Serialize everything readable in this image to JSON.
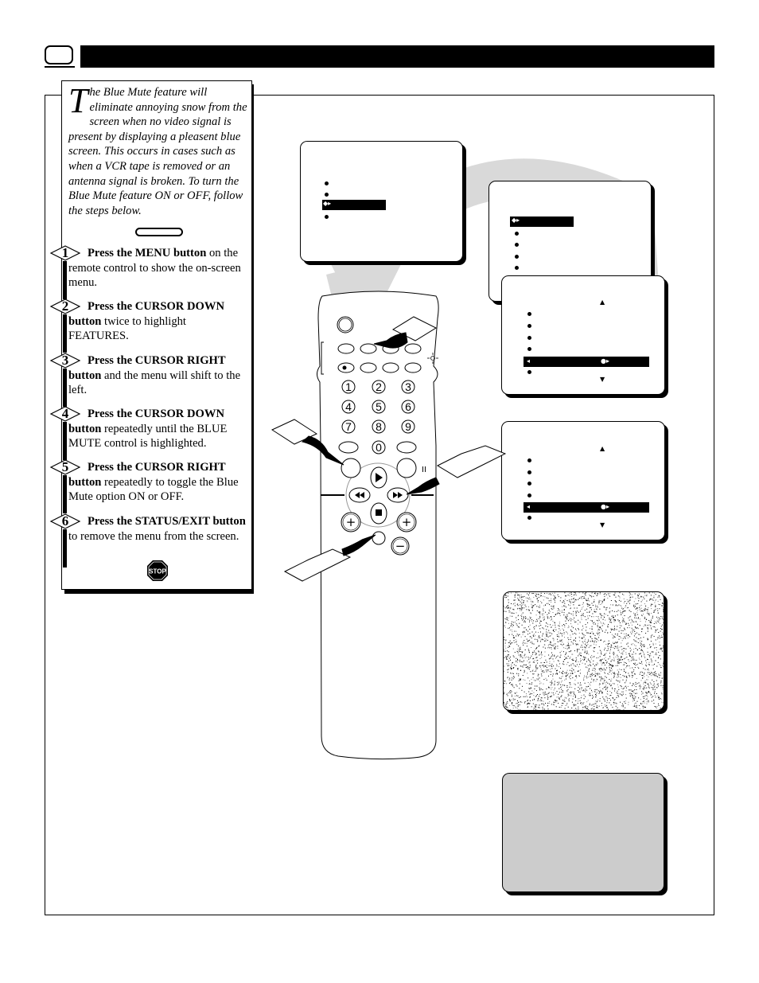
{
  "header": {
    "icon": "tv-icon",
    "title": ""
  },
  "intro": {
    "dropcap": "T",
    "text": "he Blue Mute feature will eliminate annoying snow from the screen when no video signal is present by displaying a pleasent blue screen. This occurs in cases such as when a VCR tape is removed or an antenna signal is broken. To turn the Blue Mute feature ON or OFF, follow the steps below."
  },
  "steps": [
    {
      "number": "1",
      "bold": "Press the MENU button",
      "rest": " on the remote control to show the on-screen menu."
    },
    {
      "number": "2",
      "bold": "Press the CURSOR DOWN button",
      "rest": " twice to highlight FEATURES."
    },
    {
      "number": "3",
      "bold": "Press the CURSOR RIGHT button",
      "rest": " and the menu will shift to the left."
    },
    {
      "number": "4",
      "bold": "Press the CURSOR DOWN button",
      "rest": " repeatedly until the BLUE MUTE control is highlighted."
    },
    {
      "number": "5",
      "bold": "Press the CURSOR RIGHT button",
      "rest": " repeatedly to toggle the Blue Mute option ON or OFF."
    },
    {
      "number": "6",
      "bold": "Press the STATUS/EXIT button",
      "rest": " to remove the menu from the screen."
    }
  ],
  "stop_sign": "STOP",
  "remote": {
    "number_keys": [
      "1",
      "2",
      "3",
      "4",
      "5",
      "6",
      "7",
      "8",
      "9",
      "0"
    ],
    "transport_icons": [
      "play-icon",
      "rewind-icon",
      "fast-forward-icon",
      "stop-icon",
      "pause-icon"
    ],
    "volume_plus": "+",
    "channel_plus": "+",
    "minus": "−"
  },
  "screens": {
    "main_menu": {
      "items": 4,
      "highlighted_index": 2
    },
    "features_menu": {
      "items": 6,
      "highlighted_index": 0
    },
    "features_submenu_1": {
      "up_arrow": "▲",
      "down_arrow": "▼",
      "items": 6,
      "highlighted_index": 4
    },
    "features_submenu_2": {
      "up_arrow": "▲",
      "down_arrow": "▼",
      "items": 6,
      "highlighted_index": 4
    },
    "snow_screen": {
      "label": "no signal snow"
    },
    "blue_screen": {
      "color": "#cccccc"
    }
  },
  "colors": {
    "ink": "#000000",
    "swoosh": "#d9d9d9",
    "blue_mute_screen": "#cccccc"
  }
}
